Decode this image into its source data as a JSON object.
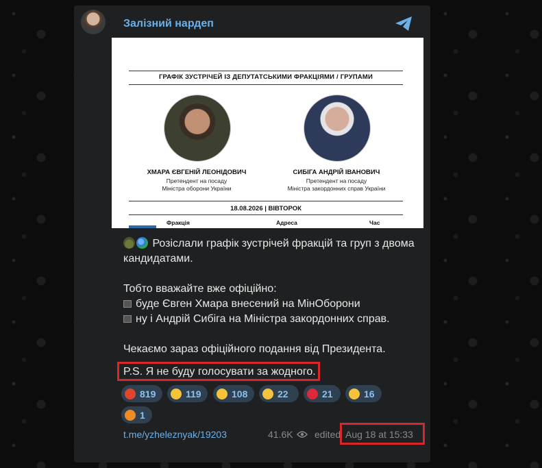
{
  "channel": {
    "name": "Залізний нардеп"
  },
  "document": {
    "title": "ГРАФІК ЗУСТРІЧЕЙ ІЗ ДЕПУТАТСЬКИМИ ФРАКЦІЯМИ / ГРУПАМИ",
    "candidates": [
      {
        "name": "ХМАРА ЄВГЕНІЙ ЛЕОНІДОВИЧ",
        "role_line1": "Претендент на посаду",
        "role_line2": "Міністра оборони України"
      },
      {
        "name": "СИБІГА АНДРІЙ ІВАНОВИЧ",
        "role_line1": "Претендент на посаду",
        "role_line2": "Міністра закордонних справ України"
      }
    ],
    "date_row": "18.08.2026   |   ВІВТОРОК",
    "columns": [
      "Фракція",
      "Адреса",
      "Час"
    ]
  },
  "message": {
    "line1": "Розіслали графік зустрічей фракцій та груп з двома кандидатами.",
    "line2": "Тобто вважайте вже офіційно:",
    "bullet1": "буде Євген Хмара внесений на МінОборони",
    "bullet2": "ну і Андрій Сибіга на Міністра закордонних справ.",
    "line3": "Чекаємо зараз офіційного подання від Президента.",
    "ps": "P.S. Я не буду голосувати за жодного."
  },
  "reactions": [
    {
      "emoji": "angry-face",
      "count": "819",
      "color": "#e0452f"
    },
    {
      "emoji": "laughing-face",
      "count": "119",
      "color": "#f5c23c"
    },
    {
      "emoji": "thumbs-up",
      "count": "108",
      "color": "#f5c23c"
    },
    {
      "emoji": "crying-face",
      "count": "22",
      "color": "#f5c23c"
    },
    {
      "emoji": "red-heart",
      "count": "21",
      "color": "#e0283c"
    },
    {
      "emoji": "exploding-head",
      "count": "16",
      "color": "#f5c23c"
    },
    {
      "emoji": "fire",
      "count": "1",
      "color": "#f08a24"
    }
  ],
  "footer": {
    "link": "t.me/yzheleznyak/19203",
    "views": "41.6K",
    "edited_label": "edited",
    "timestamp": "Aug 18 at 15:33"
  },
  "colors": {
    "accent": "#6cb0e8",
    "highlight_box": "#d8262a"
  }
}
